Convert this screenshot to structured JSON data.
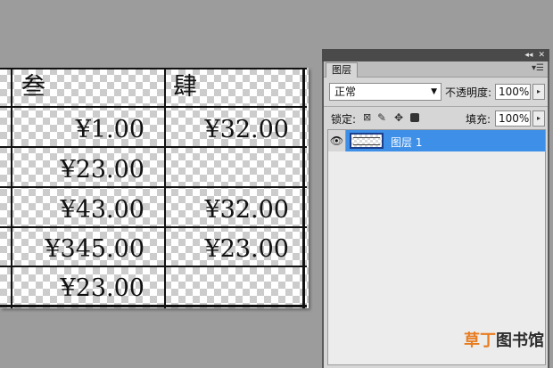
{
  "table": {
    "headers": [
      "叁",
      "肆"
    ],
    "rows": [
      [
        "¥1.00",
        "¥32.00"
      ],
      [
        "¥23.00",
        ""
      ],
      [
        "¥43.00",
        "¥32.00"
      ],
      [
        "¥345.00",
        "¥23.00"
      ],
      [
        "¥23.00",
        ""
      ]
    ]
  },
  "panel": {
    "top_buttons": [
      "◂◂",
      "✕"
    ],
    "tab": "图层",
    "menu_icon": "panel-menu-icon",
    "blend_mode": "正常",
    "opacity_label": "不透明度:",
    "opacity_value": "100%",
    "lock_label": "锁定:",
    "fill_label": "填充:",
    "fill_value": "100%",
    "layers": [
      {
        "name": "图层 1",
        "visible": true,
        "selected": true
      }
    ],
    "selected_color": "#3d8fe8"
  },
  "watermark": {
    "part1": "草丁",
    "part2": "图书馆"
  }
}
